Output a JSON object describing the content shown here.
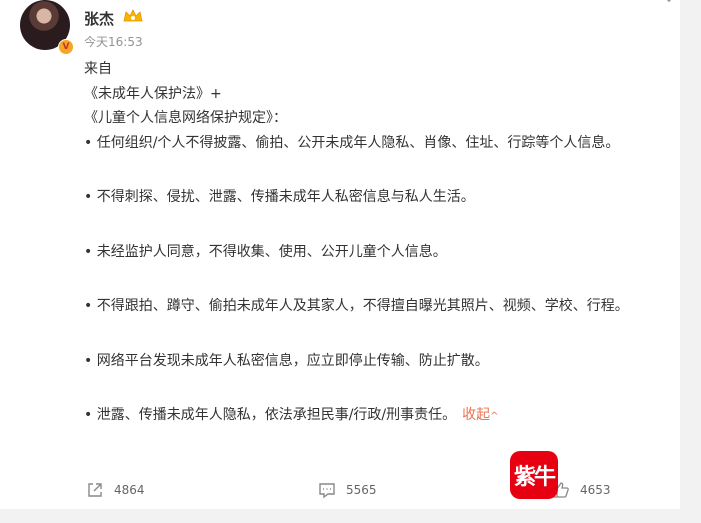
{
  "post": {
    "author": {
      "name": "张杰",
      "verified_badge_glyph": "V"
    },
    "time": "今天16:53",
    "content": {
      "line1": "来自",
      "line2": "《未成年人保护法》+",
      "line3": "《儿童个人信息网络保护规定》：",
      "bullets": [
        "• 任何组织/个人不得披露、偷拍、公开未成年人隐私、肖像、住址、行踪等个人信息。",
        "• 不得刺探、侵扰、泄露、传播未成年人私密信息与私人生活。",
        "• 未经监护人同意，不得收集、使用、公开儿童个人信息。",
        "• 不得跟拍、蹲守、偷拍未成年人及其家人，不得擅自曝光其照片、视频、学校、行程。",
        "• 网络平台发现未成年人私密信息，应立即停止传输、防止扩散。",
        "• 泄露、传播未成年人隐私，依法承担民事/行政/刑事责任。"
      ],
      "collapse_label": "收起",
      "collapse_arrow": "^"
    },
    "actions": {
      "repost_count": "4864",
      "comment_count": "5565",
      "like_count": "4653"
    }
  },
  "watermark": {
    "logo_text": "紫牛"
  },
  "colors": {
    "accent": "#eb7350",
    "logo_red": "#e60012",
    "muted": "#939393"
  }
}
